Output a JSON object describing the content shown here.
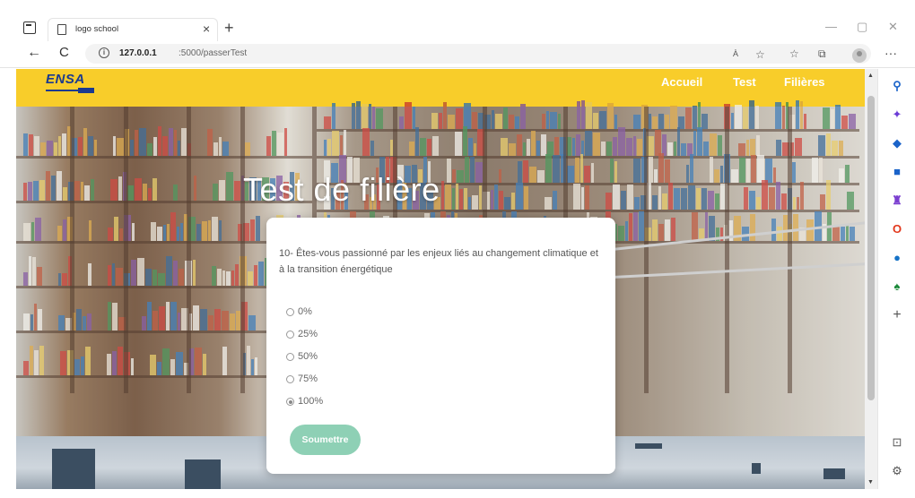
{
  "browser": {
    "tab_title": "logo school",
    "tab_close": "×",
    "new_tab": "+",
    "minimize": "—",
    "maximize": "▢",
    "close_window": "✕",
    "back": "←",
    "reload": "C",
    "url_host": "127.0.0.1",
    "url_path": ":5000/passerTest",
    "read_aloud": "À",
    "more": "···"
  },
  "site": {
    "logo_text": "ENSA",
    "nav": [
      "Accueil",
      "Test",
      "Filières"
    ]
  },
  "page": {
    "title": "Test de filière"
  },
  "quiz": {
    "question": "10- Êtes-vous passionné par les enjeux liés au changement climatique et à la transition énergétique",
    "options": [
      "0%",
      "25%",
      "50%",
      "75%",
      "100%"
    ],
    "selected_index": 4,
    "submit_label": "Soumettre"
  },
  "colors": {
    "navbar": "#f8cd2a",
    "submit_button": "#8ed0b5"
  },
  "sidebar_icons": [
    "search-icon",
    "sparkle-icon",
    "tag-icon",
    "briefcase-icon",
    "games-icon",
    "office-icon",
    "outlook-icon",
    "tree-icon",
    "add-icon",
    "panel-icon",
    "settings-icon"
  ]
}
